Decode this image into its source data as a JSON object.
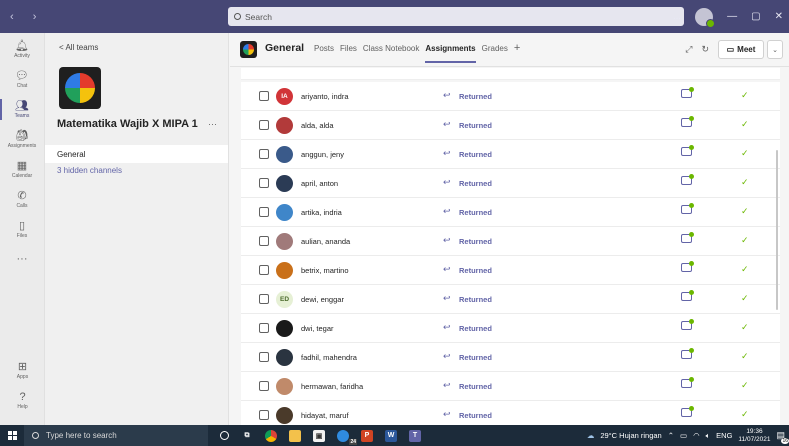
{
  "titlebar": {
    "nav_arrows": "‹ ›",
    "search_placeholder": "Search",
    "more": "...",
    "minimize": "—",
    "maximize": "▢",
    "close": "✕"
  },
  "rail": {
    "items": [
      {
        "label": "Activity",
        "icon": "bell-icon",
        "glyph": "🔔︎"
      },
      {
        "label": "Chat",
        "icon": "chat-icon",
        "glyph": "💬︎"
      },
      {
        "label": "Teams",
        "icon": "teams-icon",
        "glyph": "👥︎"
      },
      {
        "label": "Assignments",
        "icon": "assignments-icon",
        "glyph": "🎒︎"
      },
      {
        "label": "Calendar",
        "icon": "calendar-icon",
        "glyph": "▦"
      },
      {
        "label": "Calls",
        "icon": "phone-icon",
        "glyph": "✆"
      },
      {
        "label": "Files",
        "icon": "file-icon",
        "glyph": "▯"
      }
    ],
    "more": "···",
    "apps_label": "Apps",
    "help_label": "Help"
  },
  "leftpanel": {
    "back_label": "< All teams",
    "team_name": "Matematika Wajib X MIPA 1",
    "team_more": "···",
    "channel_general": "General",
    "hidden_channels": "3 hidden channels"
  },
  "header": {
    "channel_title": "General",
    "tabs": [
      "Posts",
      "Files",
      "Class Notebook",
      "Assignments",
      "Grades"
    ],
    "active_tab": "Assignments",
    "add_tab": "+",
    "expand_icon": "⤢",
    "refresh_icon": "↻",
    "meet_label": "Meet",
    "meet_dropdown": "⌄"
  },
  "students": [
    {
      "name": "ariyanto, indra",
      "initials": "IA",
      "avatar_color": "#d13438",
      "status": "Returned"
    },
    {
      "name": "alda, alda",
      "initials": "",
      "avatar_color": "#b23a3a",
      "status": "Returned"
    },
    {
      "name": "anggun, jeny",
      "initials": "",
      "avatar_color": "#3a5a8a",
      "status": "Returned"
    },
    {
      "name": "april, anton",
      "initials": "",
      "avatar_color": "#2b3b55",
      "status": "Returned"
    },
    {
      "name": "artika, indria",
      "initials": "",
      "avatar_color": "#3f86c9",
      "status": "Returned"
    },
    {
      "name": "aulian, ananda",
      "initials": "",
      "avatar_color": "#a07a7a",
      "status": "Returned"
    },
    {
      "name": "betrix, martino",
      "initials": "",
      "avatar_color": "#c9701a",
      "status": "Returned"
    },
    {
      "name": "dewi, enggar",
      "initials": "ED",
      "avatar_color": "#e6f0d5",
      "status": "Returned"
    },
    {
      "name": "dwi, tegar",
      "initials": "",
      "avatar_color": "#1a1a1a",
      "status": "Returned"
    },
    {
      "name": "fadhil, mahendra",
      "initials": "",
      "avatar_color": "#2a3440",
      "status": "Returned"
    },
    {
      "name": "hermawan, faridha",
      "initials": "",
      "avatar_color": "#c08a6a",
      "status": "Returned"
    },
    {
      "name": "hidayat, maruf",
      "initials": "",
      "avatar_color": "#4a3a2a",
      "status": "Returned"
    }
  ],
  "taskbar": {
    "search_placeholder": "Type here to search",
    "weather": "29°C  Hujan ringan",
    "lang": "ENG",
    "time": "19:36",
    "date": "11/07/2021",
    "notification_count": "16",
    "edge_badge": "24"
  }
}
